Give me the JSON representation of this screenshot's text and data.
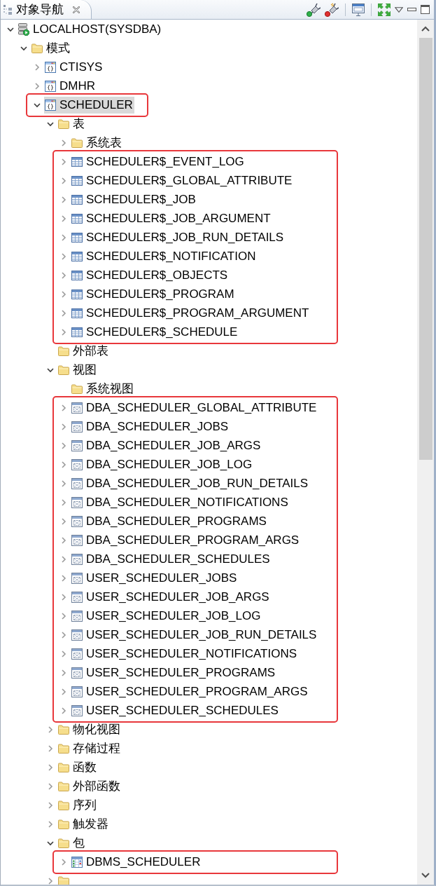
{
  "panel": {
    "title": "对象导航"
  },
  "tree": [
    {
      "label": "LOCALHOST(SYSDBA)",
      "kind": "server",
      "expanded": true,
      "selected": false,
      "marked": false,
      "children": [
        {
          "label": "模式",
          "kind": "folder",
          "expanded": true,
          "selected": false,
          "marked": false,
          "children": [
            {
              "label": "CTISYS",
              "kind": "schema",
              "expanded": false,
              "selected": false,
              "marked": false
            },
            {
              "label": "DMHR",
              "kind": "schema",
              "expanded": false,
              "selected": false,
              "marked": false
            },
            {
              "label": "SCHEDULER",
              "kind": "schema",
              "expanded": true,
              "selected": true,
              "marked": true,
              "children": [
                {
                  "label": "表",
                  "kind": "folder",
                  "expanded": true,
                  "selected": false,
                  "marked": false,
                  "children": [
                    {
                      "label": "系统表",
                      "kind": "folder",
                      "expanded": false,
                      "selected": false,
                      "marked": false
                    },
                    {
                      "label": "SCHEDULER$_EVENT_LOG",
                      "kind": "table",
                      "expanded": false,
                      "selected": false,
                      "marked": true
                    },
                    {
                      "label": "SCHEDULER$_GLOBAL_ATTRIBUTE",
                      "kind": "table",
                      "expanded": false,
                      "selected": false,
                      "marked": true
                    },
                    {
                      "label": "SCHEDULER$_JOB",
                      "kind": "table",
                      "expanded": false,
                      "selected": false,
                      "marked": true
                    },
                    {
                      "label": "SCHEDULER$_JOB_ARGUMENT",
                      "kind": "table",
                      "expanded": false,
                      "selected": false,
                      "marked": true
                    },
                    {
                      "label": "SCHEDULER$_JOB_RUN_DETAILS",
                      "kind": "table",
                      "expanded": false,
                      "selected": false,
                      "marked": true
                    },
                    {
                      "label": "SCHEDULER$_NOTIFICATION",
                      "kind": "table",
                      "expanded": false,
                      "selected": false,
                      "marked": true
                    },
                    {
                      "label": "SCHEDULER$_OBJECTS",
                      "kind": "table",
                      "expanded": false,
                      "selected": false,
                      "marked": true
                    },
                    {
                      "label": "SCHEDULER$_PROGRAM",
                      "kind": "table",
                      "expanded": false,
                      "selected": false,
                      "marked": true
                    },
                    {
                      "label": "SCHEDULER$_PROGRAM_ARGUMENT",
                      "kind": "table",
                      "expanded": false,
                      "selected": false,
                      "marked": true
                    },
                    {
                      "label": "SCHEDULER$_SCHEDULE",
                      "kind": "table",
                      "expanded": false,
                      "selected": false,
                      "marked": true
                    }
                  ]
                },
                {
                  "label": "外部表",
                  "kind": "folder",
                  "selected": false,
                  "marked": false
                },
                {
                  "label": "视图",
                  "kind": "folder",
                  "expanded": true,
                  "selected": false,
                  "marked": false,
                  "children": [
                    {
                      "label": "系统视图",
                      "kind": "folder",
                      "selected": false,
                      "marked": false
                    },
                    {
                      "label": "DBA_SCHEDULER_GLOBAL_ATTRIBUTE",
                      "kind": "view",
                      "expanded": false,
                      "selected": false,
                      "marked": true
                    },
                    {
                      "label": "DBA_SCHEDULER_JOBS",
                      "kind": "view",
                      "expanded": false,
                      "selected": false,
                      "marked": true
                    },
                    {
                      "label": "DBA_SCHEDULER_JOB_ARGS",
                      "kind": "view",
                      "expanded": false,
                      "selected": false,
                      "marked": true
                    },
                    {
                      "label": "DBA_SCHEDULER_JOB_LOG",
                      "kind": "view",
                      "expanded": false,
                      "selected": false,
                      "marked": true
                    },
                    {
                      "label": "DBA_SCHEDULER_JOB_RUN_DETAILS",
                      "kind": "view",
                      "expanded": false,
                      "selected": false,
                      "marked": true
                    },
                    {
                      "label": "DBA_SCHEDULER_NOTIFICATIONS",
                      "kind": "view",
                      "expanded": false,
                      "selected": false,
                      "marked": true
                    },
                    {
                      "label": "DBA_SCHEDULER_PROGRAMS",
                      "kind": "view",
                      "expanded": false,
                      "selected": false,
                      "marked": true
                    },
                    {
                      "label": "DBA_SCHEDULER_PROGRAM_ARGS",
                      "kind": "view",
                      "expanded": false,
                      "selected": false,
                      "marked": true
                    },
                    {
                      "label": "DBA_SCHEDULER_SCHEDULES",
                      "kind": "view",
                      "expanded": false,
                      "selected": false,
                      "marked": true
                    },
                    {
                      "label": "USER_SCHEDULER_JOBS",
                      "kind": "view",
                      "expanded": false,
                      "selected": false,
                      "marked": true
                    },
                    {
                      "label": "USER_SCHEDULER_JOB_ARGS",
                      "kind": "view",
                      "expanded": false,
                      "selected": false,
                      "marked": true
                    },
                    {
                      "label": "USER_SCHEDULER_JOB_LOG",
                      "kind": "view",
                      "expanded": false,
                      "selected": false,
                      "marked": true
                    },
                    {
                      "label": "USER_SCHEDULER_JOB_RUN_DETAILS",
                      "kind": "view",
                      "expanded": false,
                      "selected": false,
                      "marked": true
                    },
                    {
                      "label": "USER_SCHEDULER_NOTIFICATIONS",
                      "kind": "view",
                      "expanded": false,
                      "selected": false,
                      "marked": true
                    },
                    {
                      "label": "USER_SCHEDULER_PROGRAMS",
                      "kind": "view",
                      "expanded": false,
                      "selected": false,
                      "marked": true
                    },
                    {
                      "label": "USER_SCHEDULER_PROGRAM_ARGS",
                      "kind": "view",
                      "expanded": false,
                      "selected": false,
                      "marked": true
                    },
                    {
                      "label": "USER_SCHEDULER_SCHEDULES",
                      "kind": "view",
                      "expanded": false,
                      "selected": false,
                      "marked": true
                    }
                  ]
                },
                {
                  "label": "物化视图",
                  "kind": "folder",
                  "expanded": false,
                  "selected": false,
                  "marked": false
                },
                {
                  "label": "存储过程",
                  "kind": "folder",
                  "expanded": false,
                  "selected": false,
                  "marked": false
                },
                {
                  "label": "函数",
                  "kind": "folder",
                  "expanded": false,
                  "selected": false,
                  "marked": false
                },
                {
                  "label": "外部函数",
                  "kind": "folder",
                  "expanded": false,
                  "selected": false,
                  "marked": false
                },
                {
                  "label": "序列",
                  "kind": "folder",
                  "expanded": false,
                  "selected": false,
                  "marked": false
                },
                {
                  "label": "触发器",
                  "kind": "folder",
                  "expanded": false,
                  "selected": false,
                  "marked": false
                },
                {
                  "label": "包",
                  "kind": "folder",
                  "expanded": true,
                  "selected": false,
                  "marked": false,
                  "children": [
                    {
                      "label": "DBMS_SCHEDULER",
                      "kind": "package",
                      "expanded": false,
                      "selected": false,
                      "marked": true
                    }
                  ]
                },
                {
                  "kind": "folder",
                  "expanded": false,
                  "selected": false,
                  "marked": false
                }
              ]
            }
          ]
        }
      ]
    }
  ]
}
